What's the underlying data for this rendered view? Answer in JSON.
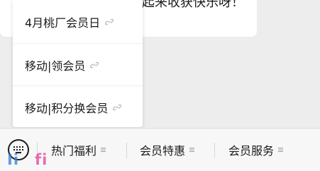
{
  "chat": {
    "message_partial": "起来收获快乐呀！"
  },
  "popup": {
    "items": [
      {
        "label": "4月桃厂会员日",
        "icon": "link-icon"
      },
      {
        "label": "移动|领会员",
        "icon": "link-icon"
      },
      {
        "label": "移动|积分换会员",
        "icon": "link-icon"
      }
    ]
  },
  "menubar": {
    "keyboard_icon": "keyboard-icon",
    "tabs": [
      {
        "label": "热门福利",
        "icon": "menu-lines-icon"
      },
      {
        "label": "会员特惠",
        "icon": "menu-lines-icon"
      },
      {
        "label": "会员服务",
        "icon": "menu-lines-icon"
      }
    ]
  },
  "watermark": {
    "part1": "Ii",
    "part2": "fi"
  },
  "colors": {
    "background": "#ededed",
    "popup_bg": "#ffffff",
    "menubar_bg": "#f7f7f7",
    "watermark_blue": "#2f7fd8",
    "watermark_pink": "#e0409a"
  }
}
